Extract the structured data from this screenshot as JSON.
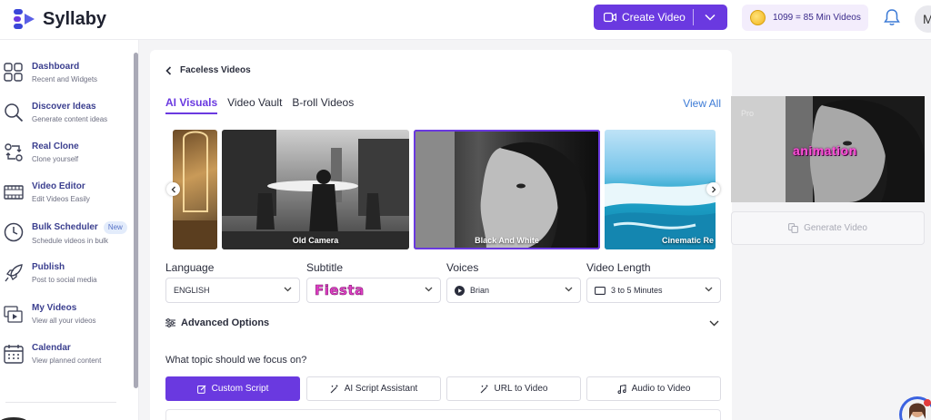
{
  "brand": {
    "name": "Syllaby"
  },
  "header": {
    "create_label": "Create Video",
    "credits_label": "1099 = 85 Min Videos",
    "avatar_initial": "M"
  },
  "sidebar": {
    "items": [
      {
        "title": "Dashboard",
        "subtitle": "Recent and Widgets",
        "icon": "dashboard-icon"
      },
      {
        "title": "Discover Ideas",
        "subtitle": "Generate content ideas",
        "icon": "search-icon"
      },
      {
        "title": "Real Clone",
        "subtitle": "Clone yourself",
        "icon": "clone-icon"
      },
      {
        "title": "Video Editor",
        "subtitle": "Edit Videos Easily",
        "icon": "film-icon"
      },
      {
        "title": "Bulk Scheduler",
        "subtitle": "Schedule videos in bulk",
        "icon": "clock-icon",
        "badge": "New"
      },
      {
        "title": "Publish",
        "subtitle": "Post to social media",
        "icon": "rocket-icon"
      },
      {
        "title": "My Videos",
        "subtitle": "View all your videos",
        "icon": "videos-icon"
      },
      {
        "title": "Calendar",
        "subtitle": "View planned content",
        "icon": "calendar-icon"
      }
    ]
  },
  "main": {
    "back_label": "Faceless Videos",
    "tabs": [
      {
        "label": "AI Visuals",
        "active": true
      },
      {
        "label": "Video Vault",
        "active": false
      },
      {
        "label": "B-roll Videos",
        "active": false
      }
    ],
    "view_all": "View All",
    "styles": [
      {
        "label": "",
        "selected": false
      },
      {
        "label": "Old Camera",
        "selected": false
      },
      {
        "label": "Black And White",
        "selected": true
      },
      {
        "label": "Cinematic Re",
        "selected": false
      }
    ],
    "fields": {
      "language": {
        "label": "Language",
        "value": "ENGLISH"
      },
      "subtitle": {
        "label": "Subtitle",
        "value": "Fiesta"
      },
      "voices": {
        "label": "Voices",
        "value": "Brian"
      },
      "length": {
        "label": "Video Length",
        "value": "3 to 5 Minutes"
      }
    },
    "advanced_label": "Advanced Options",
    "question": "What topic should we focus on?",
    "script_buttons": [
      {
        "label": "Custom Script",
        "active": true
      },
      {
        "label": "AI Script Assistant",
        "active": false
      },
      {
        "label": "URL to Video",
        "active": false
      },
      {
        "label": "Audio to Video",
        "active": false
      }
    ]
  },
  "preview": {
    "small_text": "Pro",
    "overlay_word": "animation",
    "generate_label": "Generate Video"
  },
  "colors": {
    "accent": "#6a39e0",
    "link": "#3d7bd6",
    "subtitle_style": "#e13ec6"
  }
}
